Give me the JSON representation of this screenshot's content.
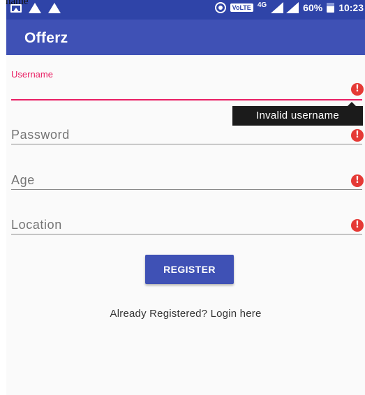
{
  "page_label": "name",
  "status_bar": {
    "network_type": "4G",
    "volte": "VoLTE",
    "battery": "60%",
    "time": "10:23"
  },
  "app_bar": {
    "title": "Offerz"
  },
  "form": {
    "username": {
      "label": "Username",
      "value": "",
      "error": true,
      "error_tooltip": "Invalid username"
    },
    "password": {
      "placeholder": "Password",
      "error": true
    },
    "age": {
      "placeholder": "Age",
      "error": true
    },
    "location": {
      "placeholder": "Location",
      "error": true
    }
  },
  "register_label": "REGISTER",
  "login_link": "Already Registered? Login here",
  "colors": {
    "primary": "#3f51b5",
    "status_bar": "#2f44a8",
    "accent": "#e91e63",
    "error": "#e53935"
  },
  "icons": [
    "image-icon",
    "warning-icon",
    "warning-icon",
    "hotspot-icon",
    "volte-icon",
    "signal-icon",
    "battery-icon",
    "error-icon"
  ]
}
